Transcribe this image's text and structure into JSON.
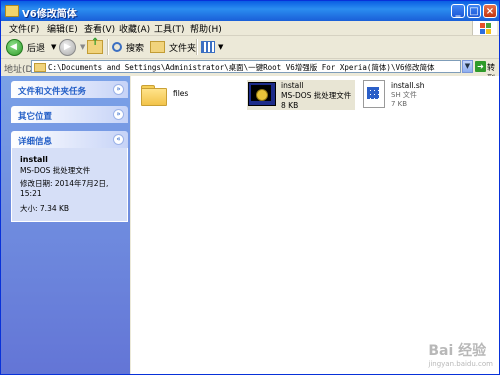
{
  "window": {
    "title": "V6修改简体"
  },
  "menu": [
    "文件(F)",
    "编辑(E)",
    "查看(V)",
    "收藏(A)",
    "工具(T)",
    "帮助(H)"
  ],
  "toolbar": {
    "back": "后退",
    "search": "搜索",
    "folders": "文件夹"
  },
  "address": {
    "label": "地址(D)",
    "path": "C:\\Documents and Settings\\Administrator\\桌面\\一键Root V6增强版 For Xperia(简体)\\V6修改简体",
    "go": "转到"
  },
  "sidebar": {
    "groups": [
      {
        "title": "文件和文件夹任务"
      },
      {
        "title": "其它位置"
      },
      {
        "title": "详细信息",
        "details": {
          "name": "install",
          "type": "MS-DOS 批处理文件",
          "modified": "修改日期: 2014年7月2日, 15:21",
          "size": "大小: 7.34 KB"
        }
      }
    ]
  },
  "files": [
    {
      "name": "files",
      "kind": "folder-icon"
    },
    {
      "name": "install",
      "type": "MS-DOS 批处理文件",
      "size": "8 KB",
      "kind": "batch-file-icon"
    },
    {
      "name": "install.sh",
      "type": "SH 文件",
      "size": "7 KB",
      "kind": "sh-file-icon"
    }
  ],
  "watermark": {
    "brand": "Bai 经验",
    "url": "jingyan.baidu.com"
  }
}
